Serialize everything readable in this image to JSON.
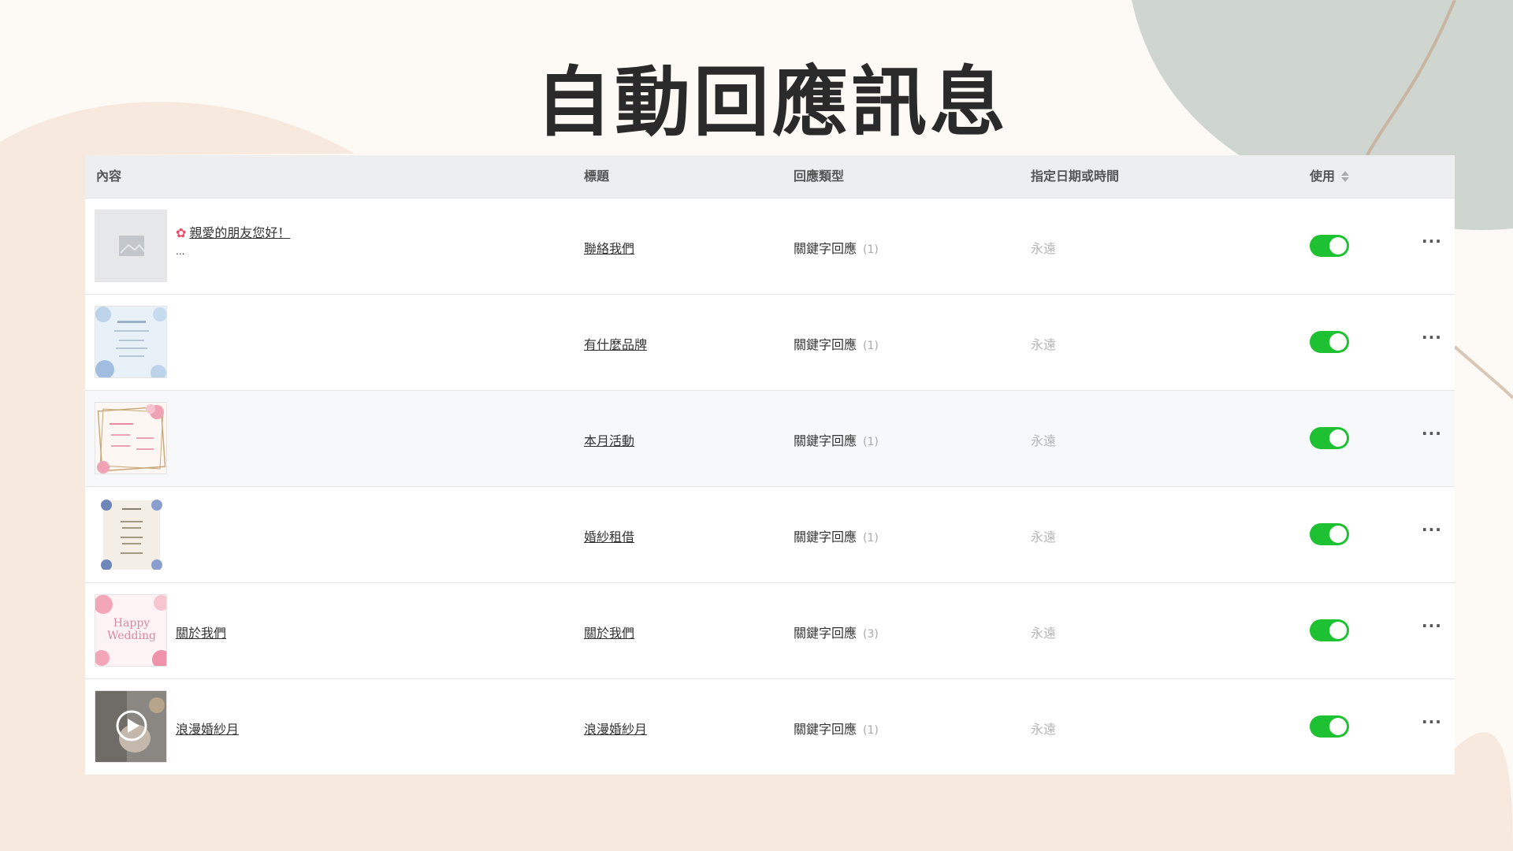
{
  "page": {
    "title": "自動回應訊息"
  },
  "colors": {
    "toggle_on": "#1ec131",
    "header_bg": "#eceef0",
    "accent_pink": "#e84c6a"
  },
  "table": {
    "headers": {
      "content": "內容",
      "title": "標題",
      "type": "回應類型",
      "date": "指定日期或時間",
      "use": "使用"
    },
    "rows": [
      {
        "thumb": "placeholder-image-icon",
        "content": "親愛的朋友您好！",
        "content_more": "...",
        "title": "聯絡我們",
        "type": "關鍵字回應",
        "count": "(1)",
        "date": "永遠",
        "enabled": true
      },
      {
        "thumb": "watercolor-card-image",
        "content": "",
        "title": "有什麼品牌",
        "type": "關鍵字回應",
        "count": "(1)",
        "date": "永遠",
        "enabled": true
      },
      {
        "thumb": "floral-frame-image",
        "content": "",
        "title": "本月活動",
        "type": "關鍵字回應",
        "count": "(1)",
        "date": "永遠",
        "enabled": true
      },
      {
        "thumb": "floral-menu-image",
        "content": "",
        "title": "婚紗租借",
        "type": "關鍵字回應",
        "count": "(1)",
        "date": "永遠",
        "enabled": true
      },
      {
        "thumb": "happy-wedding-image",
        "thumb_text_1": "Happy",
        "thumb_text_2": "Wedding",
        "content": "關於我們",
        "title": "關於我們",
        "type": "關鍵字回應",
        "count": "(3)",
        "date": "永遠",
        "enabled": true
      },
      {
        "thumb": "video-thumbnail",
        "content": "浪漫婚紗月",
        "title": "浪漫婚紗月",
        "type": "關鍵字回應",
        "count": "(1)",
        "date": "永遠",
        "enabled": true
      }
    ]
  }
}
